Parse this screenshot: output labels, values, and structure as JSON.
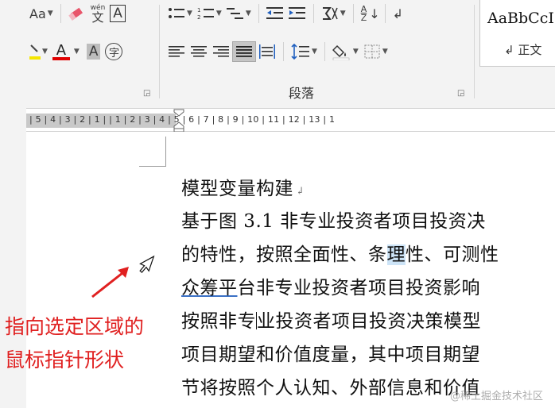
{
  "ribbon": {
    "font_group": {
      "font_size_btn": "Aa",
      "clear_format_btn": "",
      "phonetic_btn_top": "wén",
      "phonetic_btn_bottom": "文",
      "char_border_btn": "A",
      "highlight_btn": "ab",
      "font_color_btn": "A",
      "char_shading_btn": "A",
      "enclose_char_btn": "字"
    },
    "paragraph_group": {
      "label": "段落",
      "sort_btn_top": "A",
      "sort_btn_bottom": "Z"
    },
    "styles_group": {
      "sample_text": "AaBbCcI",
      "style_name": "↲ 正文"
    }
  },
  "ruler": {
    "numbers": "| 5 | 4 | 3 | 2 | 1 |    | 1 | 2 | 3 | 4 | 5 | 6 | 7 | 8 | 9 | 10 | 11 | 12 | 13 | 1"
  },
  "document": {
    "heading": "模型变量构建",
    "line1": "基于图 3.1 非专业投资者项目投资决",
    "line2_before": "的特性，按照全面性、条",
    "line2_hl": "理",
    "line2_after": "性、可测性",
    "line3_ul": "众筹平",
    "line3_rest": "台非专业投资者项目投资影响",
    "line4_before": "按照非专",
    "line4_after": "业投资者项目投资决策模型",
    "line5": "项目期望和价值度量，其中项目期望",
    "line6": "节将按照个人认知、外部信息和价值"
  },
  "annotation": {
    "line1": "指向选定区域的",
    "line2": "鼠标指针形状",
    "color": "#e02020"
  },
  "watermark": "@稀土掘金技术社区"
}
